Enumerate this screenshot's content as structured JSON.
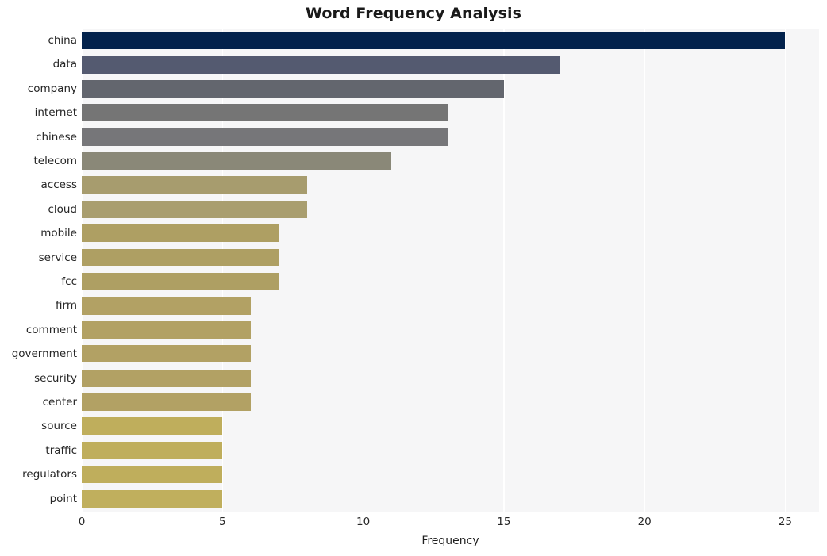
{
  "chart_data": {
    "type": "bar",
    "orientation": "horizontal",
    "title": "Word Frequency Analysis",
    "xlabel": "Frequency",
    "ylabel": "",
    "categories": [
      "china",
      "data",
      "company",
      "internet",
      "chinese",
      "telecom",
      "access",
      "cloud",
      "mobile",
      "service",
      "fcc",
      "firm",
      "comment",
      "government",
      "security",
      "center",
      "source",
      "traffic",
      "regulators",
      "point"
    ],
    "values": [
      25,
      17,
      15,
      13,
      13,
      11,
      8,
      8,
      7,
      7,
      7,
      6,
      6,
      6,
      6,
      6,
      5,
      5,
      5,
      5
    ],
    "xlim": [
      0,
      26.2
    ],
    "xticks": [
      0,
      5,
      10,
      15,
      20,
      25
    ],
    "xtick_labels": [
      "0",
      "5",
      "10",
      "15",
      "20",
      "25"
    ],
    "grid": {
      "vertical": true,
      "horizontal": false,
      "color": "#ffffff"
    },
    "legend": null,
    "bar_colors": [
      "#03224c",
      "#545a70",
      "#63666e",
      "#757575",
      "#767679",
      "#8a8878",
      "#a79c6e",
      "#a99e6f",
      "#ae9f63",
      "#ae9f63",
      "#ae9f63",
      "#b2a164",
      "#b2a164",
      "#b2a164",
      "#b2a164",
      "#b2a164",
      "#bfae5c",
      "#bfae5c",
      "#bfae5c",
      "#c0af5d"
    ],
    "plot_background": "#f6f6f7",
    "figure_background": "#ffffff",
    "style": "whitegrid"
  }
}
